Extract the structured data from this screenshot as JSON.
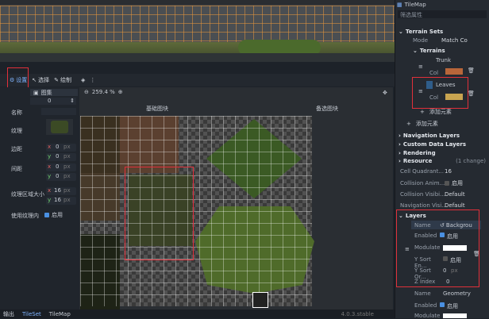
{
  "top_viewport": {
    "ruler_marks": [
      "",
      "",
      ""
    ]
  },
  "tileset_toolbar": {
    "tab_setup": "设置",
    "tab_select": "选择",
    "tab_paint": "绘制",
    "zoom": "259.4 %"
  },
  "left_panel": {
    "header": "图集",
    "id_value": "0",
    "labels": {
      "name": "名称",
      "texture": "纹理",
      "margins": "边距",
      "separation": "间距",
      "region_size": "纹理区域大小",
      "use_padding": "使用纹理内"
    },
    "xy": {
      "x": "x",
      "y": "y",
      "px": "px"
    },
    "margins": {
      "x": "0",
      "y": "0"
    },
    "separation": {
      "x": "0",
      "y": "0"
    },
    "region_size": {
      "x": "16",
      "y": "16"
    },
    "enable": "启用"
  },
  "tileset_view": {
    "base_tiles_label": "基础图块",
    "alt_tiles_label": "备选图块"
  },
  "bottom_bar": {
    "tab_output": "输出",
    "tab_tileset": "TileSet",
    "tab_tilemap": "TileMap",
    "version": "4.0.3.stable"
  },
  "inspector": {
    "title": "TileMap",
    "filter_placeholder": "筛选属性",
    "terrain_sets": "Terrain Sets",
    "mode_label": "Mode",
    "mode_value": "Match Co",
    "terrains_label": "Terrains",
    "terrain1_name": "Trunk",
    "terrain1_color_label": "Col",
    "terrain2_name": "Leaves",
    "terrain2_color_label": "Col",
    "add_element_1": "添加元素",
    "add_element_2": "添加元素",
    "navigation_layers": "Navigation Layers",
    "custom_data_layers": "Custom Data Layers",
    "rendering": "Rendering",
    "resource": "Resource",
    "resource_changes": "(1 change)",
    "cell_quadrant_label": "Cell Quadrant...",
    "cell_quadrant_value": "16",
    "collision_anim_label": "Collision Anim...",
    "collision_anim_value": "启用",
    "collision_vis_label": "Collision Visibi...",
    "collision_vis_value": "Default",
    "navigation_vis_label": "Navigation Visi...",
    "navigation_vis_value": "Default",
    "layers": "Layers",
    "layer0": {
      "name_label": "Name",
      "name_value": "Backgrou",
      "enabled_label": "Enabled",
      "enabled_value": "启用",
      "modulate_label": "Modulate",
      "ysort_en_label": "Y Sort En...",
      "ysort_en_value": "启用",
      "ysort_or_label": "Y Sort Or...",
      "ysort_or_value": "0",
      "ysort_or_unit": "px",
      "zindex_label": "Z Index",
      "zindex_value": "0"
    },
    "layer1": {
      "name_label": "Name",
      "name_value": "Geometry",
      "enabled_label": "Enabled",
      "enabled_value": "启用",
      "modulate_label": "Modulate"
    }
  },
  "colors": {
    "trunk": "#b8663a",
    "leaves": "#2f5d8a",
    "leaves_col": "#c8a450",
    "highlight": "#e0303a",
    "accent": "#4a90e2"
  }
}
